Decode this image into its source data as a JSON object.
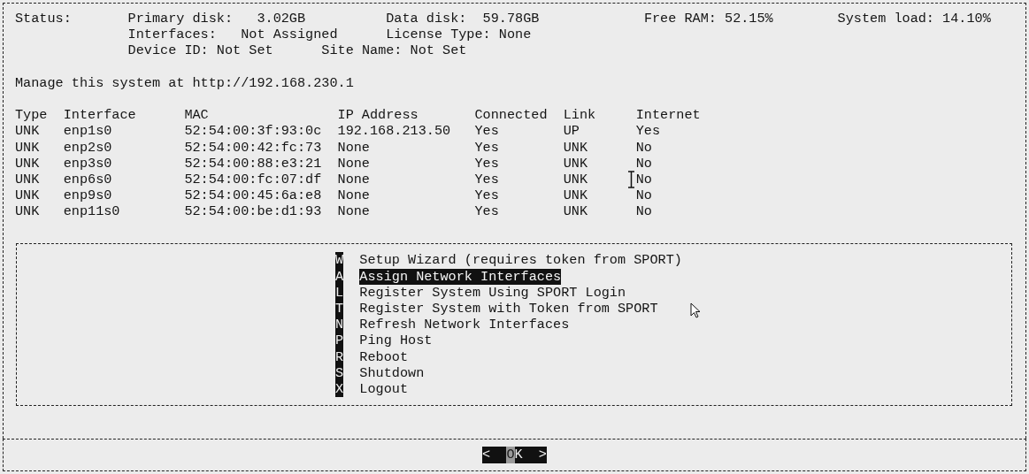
{
  "status": {
    "label": "Status:",
    "lines": [
      [
        "Primary disk:   3.02GB",
        "Data disk:  59.78GB",
        "Free RAM: 52.15%",
        "System load: 14.10%"
      ],
      [
        "Interfaces:   Not Assigned",
        "License Type: None"
      ],
      [
        "Device ID: Not Set",
        "Site Name: Not Set"
      ]
    ]
  },
  "manage_text": "Manage this system at http://192.168.230.1",
  "table": {
    "columns": [
      "Type",
      "Interface",
      "MAC",
      "IP Address",
      "Connected",
      "Link",
      "Internet"
    ],
    "rows": [
      [
        "UNK",
        "enp1s0",
        "52:54:00:3f:93:0c",
        "192.168.213.50",
        "Yes",
        "UP",
        "Yes"
      ],
      [
        "UNK",
        "enp2s0",
        "52:54:00:42:fc:73",
        "None",
        "Yes",
        "UNK",
        "No"
      ],
      [
        "UNK",
        "enp3s0",
        "52:54:00:88:e3:21",
        "None",
        "Yes",
        "UNK",
        "No"
      ],
      [
        "UNK",
        "enp6s0",
        "52:54:00:fc:07:df",
        "None",
        "Yes",
        "UNK",
        "No"
      ],
      [
        "UNK",
        "enp9s0",
        "52:54:00:45:6a:e8",
        "None",
        "Yes",
        "UNK",
        "No"
      ],
      [
        "UNK",
        "enp11s0",
        "52:54:00:be:d1:93",
        "None",
        "Yes",
        "UNK",
        "No"
      ]
    ]
  },
  "menu": [
    {
      "key": "W",
      "label": "Setup Wizard (requires token from SPORT)",
      "selected": false
    },
    {
      "key": "A",
      "label": "Assign Network Interfaces",
      "selected": true
    },
    {
      "key": "L",
      "label": "Register System Using SPORT Login",
      "selected": false
    },
    {
      "key": "T",
      "label": "Register System with Token from SPORT",
      "selected": false
    },
    {
      "key": "N",
      "label": "Refresh Network Interfaces",
      "selected": false
    },
    {
      "key": "P",
      "label": "Ping Host",
      "selected": false
    },
    {
      "key": "R",
      "label": "Reboot",
      "selected": false
    },
    {
      "key": "S",
      "label": "Shutdown",
      "selected": false
    },
    {
      "key": "X",
      "label": "Logout",
      "selected": false
    }
  ],
  "ok_button": {
    "left": "<",
    "label": "OK",
    "right": ">"
  }
}
